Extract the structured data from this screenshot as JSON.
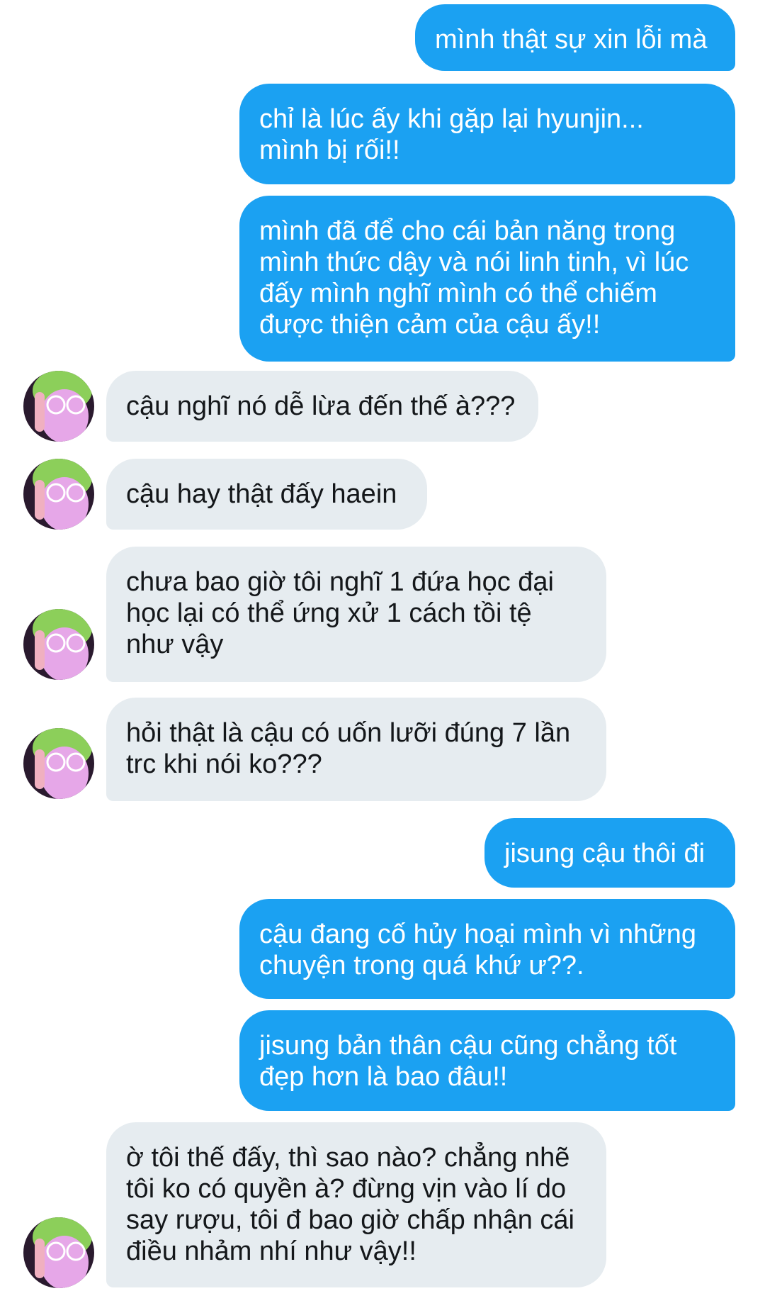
{
  "conversation": {
    "messages": [
      {
        "from": "me",
        "text": "mình thật sự xin lỗi mà"
      },
      {
        "from": "me",
        "text": "chỉ là lúc ấy khi gặp lại hyunjin...\nmình bị rối!!"
      },
      {
        "from": "me",
        "text": "mình đã để cho cái bản năng trong\nmình thức dậy và nói linh tinh, vì lúc\nđấy mình nghĩ mình có thể chiếm\nđược thiện cảm của cậu ấy!!"
      },
      {
        "from": "them",
        "text": "cậu nghĩ nó dễ lừa đến thế à???"
      },
      {
        "from": "them",
        "text": "cậu hay thật đấy haein"
      },
      {
        "from": "them",
        "text": "chưa bao giờ tôi nghĩ 1 đứa học đại\nhọc lại có thể ứng xử 1 cách tồi tệ\nnhư vậy"
      },
      {
        "from": "them",
        "text": "hỏi thật là cậu có uốn lưỡi đúng 7 lần\ntrc khi nói ko???"
      },
      {
        "from": "me",
        "text": "jisung cậu thôi đi"
      },
      {
        "from": "me",
        "text": "cậu đang cố hủy hoại mình vì những\nchuyện trong quá khứ ư??."
      },
      {
        "from": "me",
        "text": "jisung bản thân cậu cũng chẳng tốt\nđẹp hơn là bao đâu!!"
      },
      {
        "from": "them",
        "text": "ờ tôi thế đấy, thì sao nào? chẳng nhẽ\ntôi ko có quyền à? đừng vịn vào lí do\nsay rượu, tôi đ bao giờ chấp nhận cái\nđiều nhảm nhí như vậy!!"
      }
    ]
  },
  "colors": {
    "outgoing_bubble": "#1ba1f2",
    "incoming_bubble": "#e6ecf0",
    "outgoing_text": "#ffffff",
    "incoming_text": "#14171a"
  },
  "icons": {
    "avatar": "contact-avatar"
  }
}
